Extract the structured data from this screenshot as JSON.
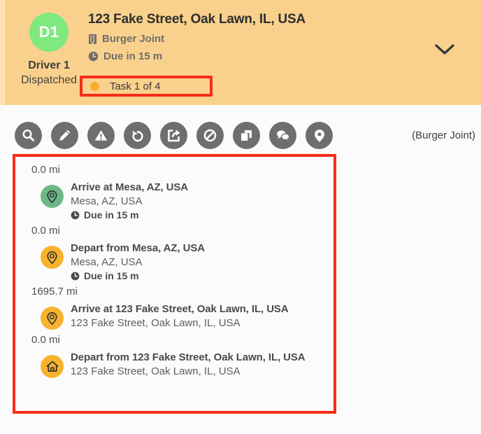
{
  "header": {
    "avatar_initials": "D1",
    "driver_name": "Driver 1",
    "driver_status": "Dispatched",
    "title": "123 Fake Street, Oak Lawn, IL, USA",
    "place": "Burger Joint",
    "due": "Due in 15 m",
    "task_progress": "Task 1 of 4",
    "building_icon": "building-icon",
    "clock_icon": "clock-icon",
    "collapse_icon": "chevron-down-icon",
    "colors": {
      "card_background": "#fad18c",
      "status_stripe": "#fde1b6",
      "avatar": "#7fe87f",
      "task_dot": "#f7ae30",
      "highlight_border": "#fa2b18"
    }
  },
  "toolbar": {
    "note": "(Burger Joint)",
    "buttons": [
      {
        "name": "search-icon",
        "label": "Search"
      },
      {
        "name": "edit-pencil-icon",
        "label": "Edit"
      },
      {
        "name": "warning-triangle-icon",
        "label": "Exception"
      },
      {
        "name": "undo-arrow-icon",
        "label": "Undo"
      },
      {
        "name": "share-export-icon",
        "label": "Share"
      },
      {
        "name": "block-prohibited-icon",
        "label": "Cancel"
      },
      {
        "name": "copy-duplicate-icon",
        "label": "Duplicate"
      },
      {
        "name": "chat-bubble-icon",
        "label": "Messages"
      },
      {
        "name": "location-pin-icon",
        "label": "Locate"
      }
    ]
  },
  "stops": [
    {
      "distance": "0.0 mi",
      "badge": "map-pin-icon",
      "badge_color": "green",
      "title": "Arrive at Mesa, AZ, USA",
      "address": "Mesa, AZ, USA",
      "due": "Due in 15 m"
    },
    {
      "distance": "0.0 mi",
      "badge": "map-pin-icon",
      "badge_color": "orange",
      "title": "Depart from Mesa, AZ, USA",
      "address": "Mesa, AZ, USA",
      "due": "Due in 15 m"
    },
    {
      "distance": "1695.7 mi",
      "badge": "map-pin-icon",
      "badge_color": "orange",
      "title": "Arrive at 123 Fake Street, Oak Lawn, IL, USA",
      "address": "123 Fake Street, Oak Lawn, IL, USA",
      "due": ""
    },
    {
      "distance": "0.0 mi",
      "badge": "home-icon",
      "badge_color": "orange",
      "title": "Depart from 123 Fake Street, Oak Lawn, IL, USA",
      "address": "123 Fake Street, Oak Lawn, IL, USA",
      "due": ""
    }
  ]
}
